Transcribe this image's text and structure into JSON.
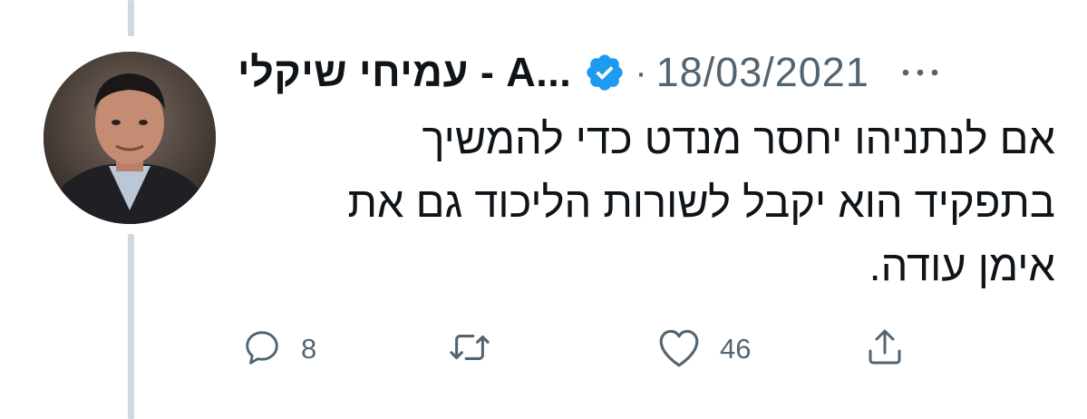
{
  "tweet": {
    "display_name": "עמיחי שיקלי - A...",
    "date": "18/03/2021",
    "separator": "·",
    "verified": true,
    "text": "אם לנתניהו יחסר מנדט כדי להמשיך\nבתפקיד הוא יקבל לשורות הליכוד גם את\nאימן עודה.",
    "avatar_icon": "profile-photo"
  },
  "actions": {
    "reply": {
      "icon": "reply-icon",
      "count": "8"
    },
    "retweet": {
      "icon": "retweet-icon",
      "count": ""
    },
    "like": {
      "icon": "heart-icon",
      "count": "46"
    },
    "share": {
      "icon": "share-icon"
    }
  },
  "colors": {
    "text": "#0f1419",
    "secondary": "#536471",
    "verified": "#1d9bf0",
    "thread_line": "#cfd9de"
  }
}
